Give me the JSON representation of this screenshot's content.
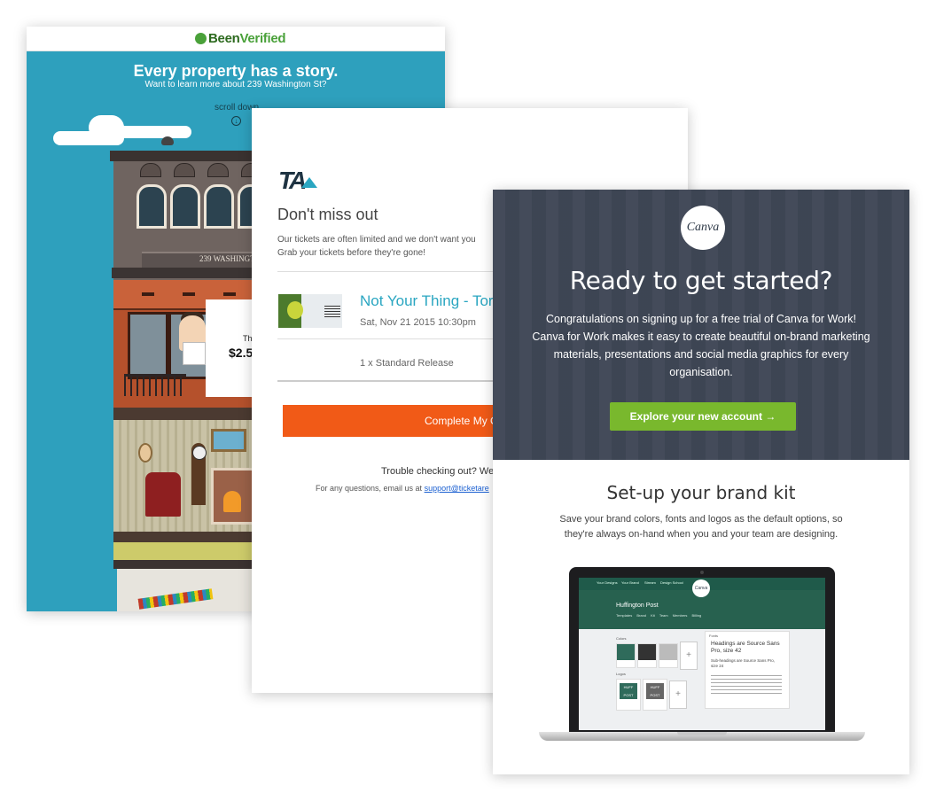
{
  "beenverified": {
    "brand_prefix": "Been",
    "brand_suffix": "Verified",
    "title": "Every property has a story.",
    "subtitle": "Want to learn more about 239 Washington St?",
    "scroll_label": "scroll down",
    "scroll_icon": "↓",
    "building_sign": "239 WASHINGT",
    "price_label": "Th",
    "price_value": "$2.5"
  },
  "ticketarena": {
    "logo": "TA",
    "heading": "Don't miss out",
    "body": "Our tickets are often limited and we don't want you Grab your tickets before they're gone!",
    "event_title": "Not Your Thing - Tor",
    "event_date": "Sat, Nov 21 2015 10:30pm",
    "ticket_qty": "1 x Standard Release",
    "cta_label": "Complete My C",
    "trouble_text": "Trouble checking out? We",
    "help_prefix": "For any questions, email us at",
    "help_email": "support@ticketare"
  },
  "canva": {
    "logo": "Canva",
    "hero_title": "Ready to get started?",
    "hero_body": "Congratulations on signing up for a free trial of Canva for Work! Canva for Work makes it easy to create beautiful on-brand marketing materials, presentations and social media graphics for every organisation.",
    "cta_label": "Explore your new account →",
    "section_title": "Set-up your brand kit",
    "section_body": "Save your brand colors, fonts and logos as the default options, so they're always on-hand when you and your team are designing.",
    "colors": {
      "hero_bg": "#3f4756",
      "cta_bg": "#79b82d"
    },
    "screen": {
      "nav": [
        "Your Designs",
        "Your Brand",
        "Stream",
        "Design School"
      ],
      "logo": "Canva",
      "brand_name": "Huffington Post",
      "tabs": "Templates Brand Kit Team Members Billing",
      "colors_label": "Colors",
      "swatch_colors": [
        "#2f6b5b",
        "#333333",
        "#bbbbbb"
      ],
      "logos_label": "Logos",
      "logo_tile_text": "HUFF POST",
      "plus": "+",
      "fonts_label": "Fonts",
      "font_heading": "Headings are Source Sans Pro, size 42",
      "font_sub": "Sub-headings are Source Sans Pro, size 24"
    }
  }
}
